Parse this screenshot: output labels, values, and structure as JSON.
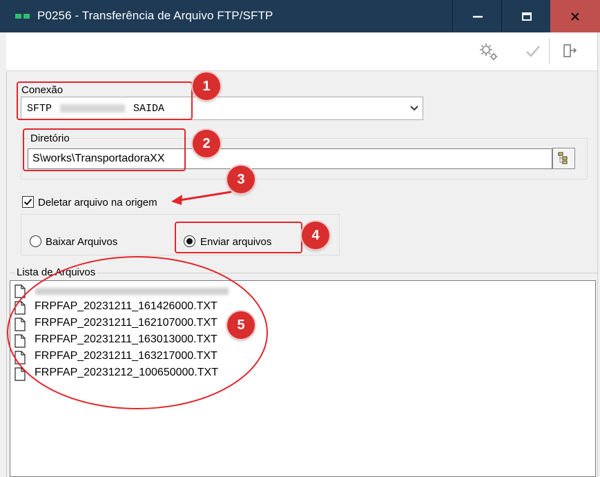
{
  "window": {
    "title": "P0256 - Transferência de Arquivo FTP/SFTP"
  },
  "toolbar": {
    "settings_icon": "gears-icon",
    "confirm_icon": "checkmark-icon",
    "exit_icon": "exit-door-icon"
  },
  "conexao": {
    "label": "Conexão",
    "value_prefix": "SFTP",
    "value_suffix": "SAIDA"
  },
  "diretorio": {
    "label": "Diretório",
    "value": "S\\works\\TransportadoraXX"
  },
  "options": {
    "delete_label": "Deletar arquivo na origem",
    "delete_checked": true,
    "download_label": "Baixar Arquivos",
    "upload_label": "Enviar arquivos",
    "selected": "upload"
  },
  "file_list": {
    "label": "Lista de Arquivos",
    "files": [
      "FRPFAP_20231211_161426000.TXT",
      "FRPFAP_20231211_162107000.TXT",
      "FRPFAP_20231211_163013000.TXT",
      "FRPFAP_20231211_163217000.TXT",
      "FRPFAP_20231212_100650000.TXT"
    ]
  },
  "annotations": {
    "badge1": "1",
    "badge2": "2",
    "badge3": "3",
    "badge4": "4",
    "badge5": "5",
    "color": "#d92e2e"
  },
  "colors": {
    "titlebar": "#1e3a55",
    "close_button": "#c0504d",
    "app_icon": "#2fbf71"
  }
}
